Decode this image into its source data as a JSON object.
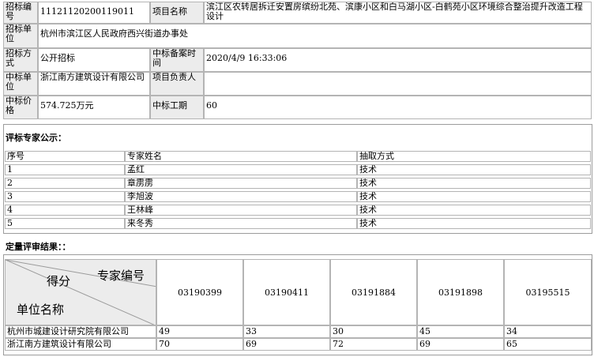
{
  "info": {
    "bid_no_label": "招标编号",
    "bid_no": "11121120200119011",
    "project_name_label": "项目名称",
    "project_name": "滨江区农转居拆迁安置房缤纷北苑、滨康小区和白马湖小区-白鹤苑小区环境综合整治提升改造工程设计",
    "tender_unit_label": "招标单位",
    "tender_unit": "杭州市滨江区人民政府西兴街道办事处",
    "tender_method_label": "招标方式",
    "tender_method": "公开招标",
    "filing_time_label": "中标备案时间",
    "filing_time": "2020/4/9 16:33:06",
    "winner_label": "中标单位",
    "winner": "浙江南方建筑设计有限公司",
    "leader_label": "项目负责人",
    "leader": "",
    "price_label": "中标价格",
    "price": "574.725万元",
    "period_label": "中标工期",
    "period": "60"
  },
  "experts": {
    "title": "评标专家公示：",
    "headers": [
      "序号",
      "专家姓名",
      "抽取方式"
    ],
    "rows": [
      [
        "1",
        "孟红",
        "技术"
      ],
      [
        "2",
        "章雳雳",
        "技术"
      ],
      [
        "3",
        "李旭波",
        "技术"
      ],
      [
        "4",
        "王林峰",
        "技术"
      ],
      [
        "5",
        "来冬秀",
        "技术"
      ]
    ]
  },
  "results": {
    "title": "定量评审结果：：",
    "head_expert": "专家编号",
    "head_score": "得分",
    "head_unit": "单位名称",
    "codes": [
      "03190399",
      "03190411",
      "03191884",
      "03191898",
      "03195515"
    ],
    "rows": [
      {
        "unit": "杭州市城建设计研究院有限公司",
        "scores": [
          "49",
          "33",
          "30",
          "45",
          "34"
        ]
      },
      {
        "unit": "浙江南方建筑设计有限公司",
        "scores": [
          "70",
          "69",
          "72",
          "69",
          "65"
        ]
      }
    ]
  }
}
